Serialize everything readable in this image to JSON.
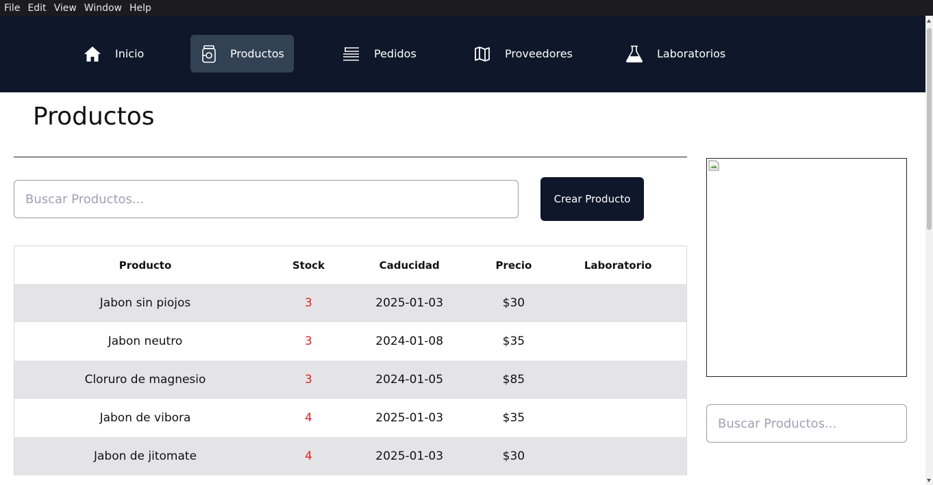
{
  "menubar": {
    "items": [
      "File",
      "Edit",
      "View",
      "Window",
      "Help"
    ]
  },
  "nav": {
    "items": [
      {
        "label": "Inicio",
        "icon": "home-icon"
      },
      {
        "label": "Productos",
        "icon": "jar-icon",
        "active": true
      },
      {
        "label": "Pedidos",
        "icon": "list-icon"
      },
      {
        "label": "Proveedores",
        "icon": "map-icon"
      },
      {
        "label": "Laboratorios",
        "icon": "flask-icon"
      }
    ],
    "colors": {
      "background": "#0f172a",
      "active": "#334155"
    }
  },
  "page": {
    "title": "Productos"
  },
  "search": {
    "placeholder": "Buscar Productos..."
  },
  "actions": {
    "create_label": "Crear Producto"
  },
  "table": {
    "headers": [
      "Producto",
      "Stock",
      "Caducidad",
      "Precio",
      "Laboratorio"
    ],
    "rows": [
      {
        "producto": "Jabon sin piojos",
        "stock": "3",
        "caducidad": "2025-01-03",
        "precio": "$30",
        "laboratorio": ""
      },
      {
        "producto": "Jabon neutro",
        "stock": "3",
        "caducidad": "2024-01-08",
        "precio": "$35",
        "laboratorio": ""
      },
      {
        "producto": "Cloruro de magnesio",
        "stock": "3",
        "caducidad": "2024-01-05",
        "precio": "$85",
        "laboratorio": ""
      },
      {
        "producto": "Jabon de vibora",
        "stock": "4",
        "caducidad": "2025-01-03",
        "precio": "$35",
        "laboratorio": ""
      },
      {
        "producto": "Jabon de jitomate",
        "stock": "4",
        "caducidad": "2025-01-03",
        "precio": "$30",
        "laboratorio": ""
      }
    ],
    "stock_color": "#dc2626"
  },
  "sidebar": {
    "search_placeholder": "Buscar Productos..."
  }
}
